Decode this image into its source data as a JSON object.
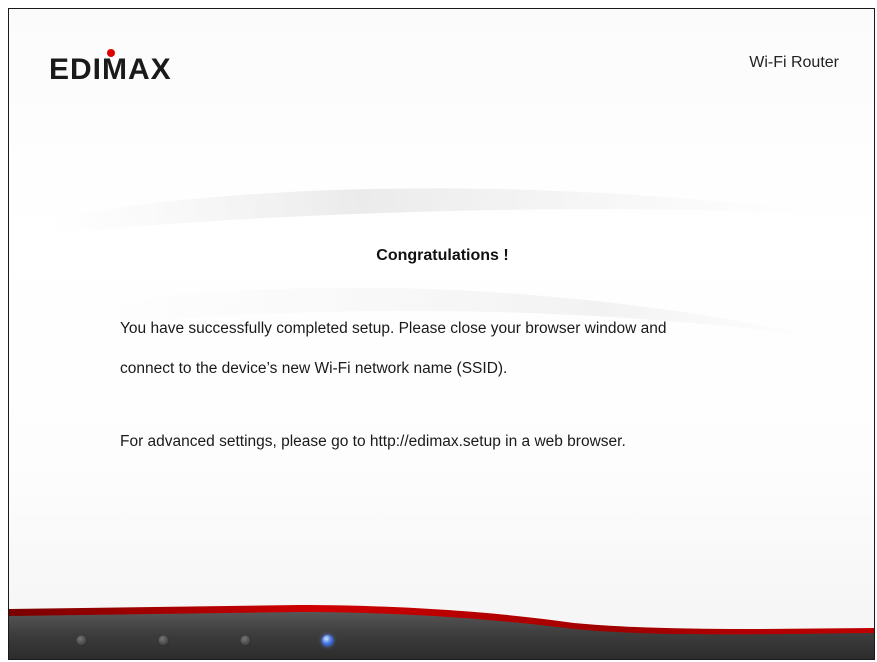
{
  "header": {
    "brand": "EDIMAX",
    "product_name": "Wi-Fi Router"
  },
  "main": {
    "headline": "Congratulations !",
    "message_line_1": "You have successfully completed setup. Please close your browser window and",
    "message_line_2": "connect to the device’s new Wi-Fi network name (SSID).",
    "message_line_3": "For advanced settings, please go to http://edimax.setup in a web browser."
  },
  "progress": {
    "steps_total": 4,
    "current_step": 4
  },
  "colors": {
    "brand_red": "#e00000",
    "footer_dark": "#3a3a3a",
    "footer_red": "#b00000",
    "active_led": "#4d7eea"
  }
}
